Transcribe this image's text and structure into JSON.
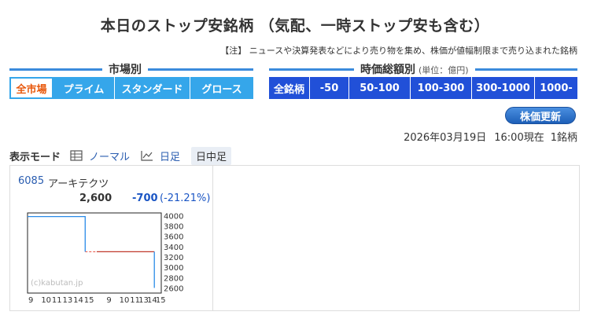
{
  "page": {
    "title": "本日のストップ安銘柄 （気配、一時ストップ安も含む）",
    "note": "【注】 ニュースや決算発表などにより売り物を集め、株価が値幅制限まで売り込まれた銘柄"
  },
  "market_filter": {
    "heading": "市場別",
    "tabs": [
      "全市場",
      "プライム",
      "スタンダード",
      "グロース"
    ],
    "active_index": 0
  },
  "cap_filter": {
    "heading": "時価総額別",
    "unit": "(単位：億円)",
    "tabs": [
      "全銘柄",
      "-50",
      "50-100",
      "100-300",
      "300-1000",
      "1000-"
    ]
  },
  "update_button": "株価更新",
  "status": {
    "date": "2026年03月19日",
    "time": "16:00現在",
    "count": "1銘柄"
  },
  "display_mode": {
    "label": "表示モード",
    "options": [
      "ノーマル",
      "日足",
      "日中足"
    ],
    "active_index": 2
  },
  "stock": {
    "code": "6085",
    "name": "アーキテクツ",
    "price": "2,600",
    "change": "-700",
    "change_pct": "(-21.21%)"
  },
  "chart_data": {
    "type": "line",
    "watermark": "(c)kabutan.jp",
    "y_ticks": [
      4000,
      3800,
      3600,
      3400,
      3200,
      3000,
      2800,
      2600
    ],
    "ylim": [
      2500,
      4050
    ],
    "x_ticks_left": [
      "9",
      "10",
      "11",
      "13",
      "14",
      "15"
    ],
    "x_ticks_right": [
      "9",
      "10",
      "11",
      "13",
      "14",
      "15"
    ],
    "series": [
      {
        "values": [
          [
            0,
            3980
          ],
          [
            5,
            3980
          ],
          [
            5,
            3300
          ]
        ],
        "color": "#2a8be8"
      },
      {
        "values": [
          [
            6,
            3300
          ],
          [
            11,
            3300
          ]
        ],
        "color": "#c0392b"
      },
      {
        "values": [
          [
            11,
            3300
          ],
          [
            11,
            2600
          ]
        ],
        "color": "#2a8be8"
      }
    ],
    "limit_line": {
      "value": 3300,
      "from": 5,
      "to": 6,
      "color": "#e74c3c"
    },
    "colors": {
      "up": "#2a8be8",
      "ref": "#c0392b"
    }
  }
}
